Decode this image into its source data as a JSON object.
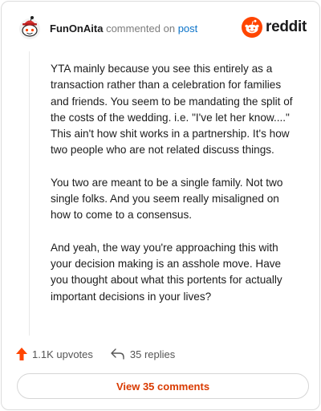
{
  "header": {
    "username": "FunOnAita",
    "commented_text": "commented on",
    "post_link": "post",
    "brand_name": "reddit",
    "brand_color": "#ff4500"
  },
  "comment": {
    "paragraphs": [
      "YTA mainly because you see this entirely as a transaction rather than a celebration for families and friends. You seem to be mandating the split of the costs of the wedding. i.e. \"I've let her know....\" This ain't how shit works in a partnership. It's how two people who are not related discuss things.",
      "You two are meant to be a single family. Not two single folks. And you seem really misaligned on how to come to a consensus.",
      "And yeah, the way you're approaching this with your decision making is an asshole move. Have you thought about what this portents for actually important decisions in your lives?"
    ]
  },
  "actions": {
    "upvotes_label": "1.1K upvotes",
    "replies_label": "35 replies",
    "upvote_icon": "upvote-arrow-icon",
    "reply_icon": "reply-arrow-icon"
  },
  "footer": {
    "view_comments_label": "View 35 comments",
    "accent_color": "#d93a00"
  }
}
